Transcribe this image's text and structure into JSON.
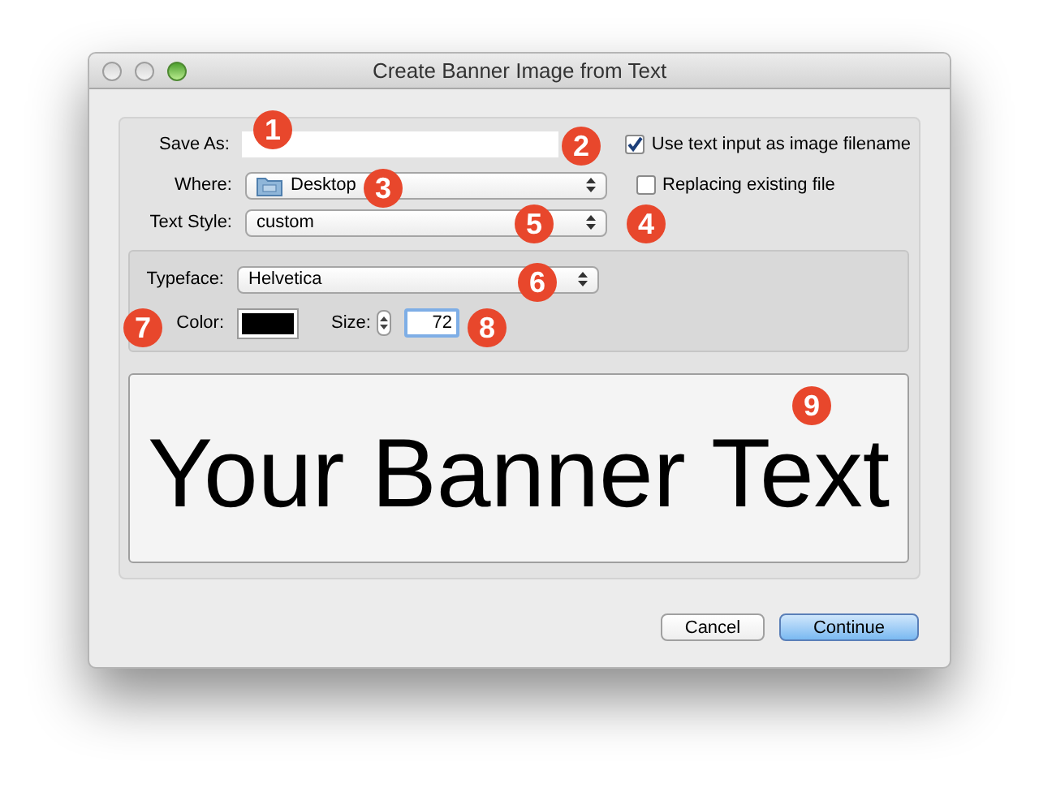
{
  "window": {
    "title": "Create Banner Image from Text"
  },
  "save_as": {
    "label": "Save As:"
  },
  "use_filename": {
    "label": "Use text input as image filename",
    "checked": true
  },
  "where": {
    "label": "Where:",
    "value": "Desktop"
  },
  "replacing": {
    "label": "Replacing existing file",
    "checked": false
  },
  "text_style": {
    "label": "Text Style:",
    "value": "custom"
  },
  "typeface": {
    "label": "Typeface:",
    "value": "Helvetica"
  },
  "color": {
    "label": "Color:",
    "color": "#000000"
  },
  "size": {
    "label": "Size:",
    "value": "72"
  },
  "preview": {
    "text": "Your Banner Text"
  },
  "buttons": [
    {
      "label": "Cancel",
      "kind": "normal"
    },
    {
      "label": "Continue",
      "kind": "default"
    }
  ],
  "callouts": [
    {
      "number": "1"
    },
    {
      "number": "2"
    },
    {
      "number": "3"
    },
    {
      "number": "4"
    },
    {
      "number": "5"
    },
    {
      "number": "6"
    },
    {
      "number": "7"
    },
    {
      "number": "8"
    },
    {
      "number": "9"
    }
  ]
}
